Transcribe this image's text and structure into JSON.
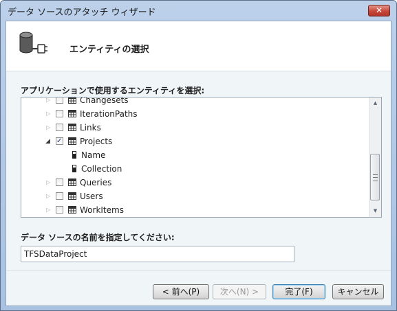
{
  "window": {
    "title": "データ ソースのアタッチ ウィザード",
    "close_label": "✕"
  },
  "header": {
    "icon": "database-plug-icon",
    "title": "エンティティの選択"
  },
  "entities": {
    "label": "アプリケーションで使用するエンティティを選択:",
    "items": [
      {
        "label": "Changesets",
        "level": 0,
        "expander": "collapsed",
        "checked": false,
        "icon": "table-icon"
      },
      {
        "label": "IterationPaths",
        "level": 0,
        "expander": "collapsed",
        "checked": false,
        "icon": "table-icon"
      },
      {
        "label": "Links",
        "level": 0,
        "expander": "collapsed",
        "checked": false,
        "icon": "table-icon"
      },
      {
        "label": "Projects",
        "level": 0,
        "expander": "expanded",
        "checked": true,
        "icon": "table-icon"
      },
      {
        "label": "Name",
        "level": 1,
        "expander": "none",
        "checked": null,
        "icon": "property-icon"
      },
      {
        "label": "Collection",
        "level": 1,
        "expander": "none",
        "checked": null,
        "icon": "property-icon"
      },
      {
        "label": "Queries",
        "level": 0,
        "expander": "collapsed",
        "checked": false,
        "icon": "table-icon"
      },
      {
        "label": "Users",
        "level": 0,
        "expander": "collapsed",
        "checked": false,
        "icon": "table-icon"
      },
      {
        "label": "WorkItems",
        "level": 0,
        "expander": "collapsed",
        "checked": false,
        "icon": "table-icon"
      }
    ]
  },
  "datasource": {
    "label": "データ ソースの名前を指定してください:",
    "value": "TFSDataProject"
  },
  "buttons": {
    "back": "< 前へ(P)",
    "next": "次へ(N) >",
    "finish": "完了(F)",
    "cancel": "キャンセル"
  },
  "colors": {
    "title_bar": "#bcd0ea",
    "panel": "#f0f6f7",
    "close": "#c6483b",
    "check": "#23377a"
  }
}
